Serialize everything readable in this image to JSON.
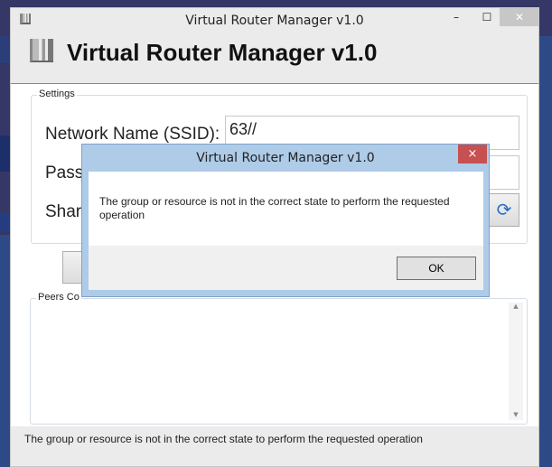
{
  "window": {
    "title": "Virtual Router Manager v1.0",
    "minimize_icon": "minimize-icon",
    "maximize_icon": "maximize-icon",
    "close_icon": "close-icon"
  },
  "header": {
    "title": "Virtual Router Manager v1.0",
    "icon": "router-signal-icon"
  },
  "settings": {
    "group_label": "Settings",
    "network_name_label": "Network Name (SSID):",
    "network_name_value": "63//",
    "password_label": "Passw",
    "shared_label": "Share",
    "refresh_icon": "refresh-icon"
  },
  "peers": {
    "group_label": "Peers Co"
  },
  "status_bar": {
    "text": "The group or resource is not in the correct state to perform the requested operation"
  },
  "dialog": {
    "title": "Virtual Router Manager v1.0",
    "message": "The group or resource is not in the correct state to perform the requested operation",
    "ok_label": "OK",
    "close_label": "×"
  },
  "colors": {
    "desktop": "#353766",
    "dialog_frame": "#aecbe8",
    "dialog_close": "#c75050"
  }
}
